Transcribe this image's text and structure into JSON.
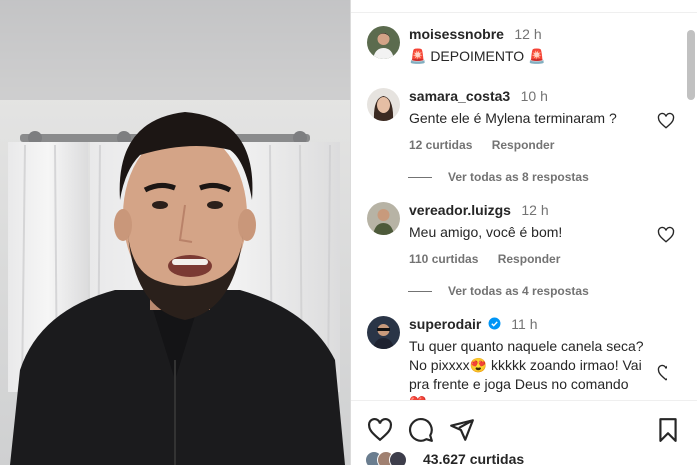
{
  "post": {
    "author": "moisessnobre",
    "time": "12 h",
    "caption": "🚨 DEPOIMENTO 🚨"
  },
  "comments": [
    {
      "user": "samara_costa3",
      "time": "10 h",
      "text": "Gente ele é Mylena terminaram ?",
      "likes": "12 curtidas",
      "reply": "Responder",
      "view_replies": "Ver todas as 8 respostas"
    },
    {
      "user": "vereador.luizgs",
      "time": "12 h",
      "text": "Meu amigo, você é bom!",
      "likes": "110 curtidas",
      "reply": "Responder",
      "view_replies": "Ver todas as 4 respostas"
    },
    {
      "user": "superodair",
      "time": "11 h",
      "text": "Tu quer quanto naquele canela seca? No pixxxx😍 kkkkk zoando irmao! Vai pra frente e joga Deus no comando ❤️"
    }
  ],
  "footer": {
    "likes_count": "43.627 curtidas"
  },
  "icons": [
    "heart-icon",
    "comment-icon",
    "share-icon",
    "save-icon",
    "verified-icon"
  ],
  "colors": {
    "verified": "#0095f6",
    "text": "#262626",
    "muted": "#737373"
  }
}
